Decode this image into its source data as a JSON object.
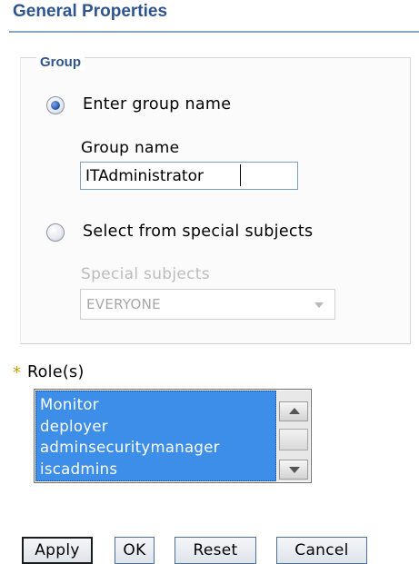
{
  "header": {
    "title": "General Properties"
  },
  "group": {
    "legend": "Group",
    "enter_group_option": {
      "label": "Enter group name",
      "checked": true
    },
    "group_name": {
      "label": "Group name",
      "value": "ITAdministrator"
    },
    "special_subjects_option": {
      "label": "Select from special subjects",
      "checked": false
    },
    "special_subjects": {
      "label": "Special subjects",
      "selected": "EVERYONE",
      "disabled": true
    }
  },
  "roles": {
    "required_mark": "*",
    "label": "Role(s)",
    "items": [
      "Monitor",
      "deployer",
      "adminsecuritymanager",
      "iscadmins"
    ]
  },
  "buttons": {
    "apply": "Apply",
    "ok": "OK",
    "reset": "Reset",
    "cancel": "Cancel"
  },
  "colors": {
    "header_text": "#2f5591",
    "selection": "#3d8ee8",
    "required_star": "#c8a000"
  }
}
